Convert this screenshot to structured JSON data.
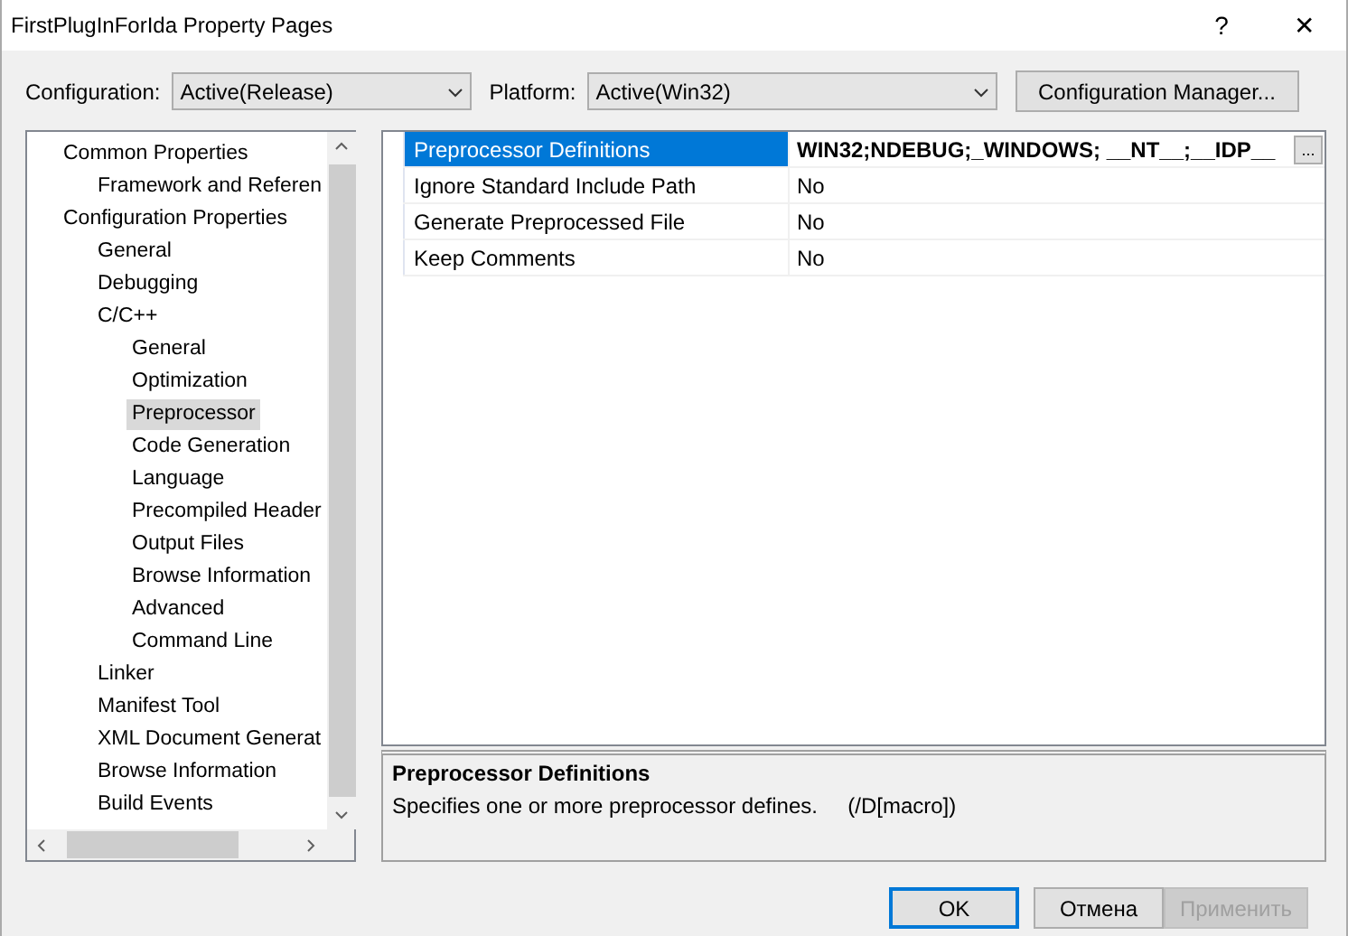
{
  "window": {
    "title": "FirstPlugInForIda Property Pages",
    "help": "?",
    "close": "✕"
  },
  "toolbar": {
    "configuration_label": "Configuration:",
    "configuration": "Active(Release)",
    "platform_label": "Platform:",
    "platform": "Active(Win32)",
    "manager_button": "Configuration Manager..."
  },
  "tree": [
    {
      "label": "Common Properties",
      "selected": false,
      "children": [
        {
          "label": "Framework and Referen",
          "selected": false
        }
      ]
    },
    {
      "label": "Configuration Properties",
      "selected": false,
      "children": [
        {
          "label": "General",
          "selected": false
        },
        {
          "label": "Debugging",
          "selected": false
        },
        {
          "label": "C/C++",
          "selected": false,
          "children": [
            {
              "label": "General",
              "selected": false
            },
            {
              "label": "Optimization",
              "selected": false
            },
            {
              "label": "Preprocessor",
              "selected": true
            },
            {
              "label": "Code Generation",
              "selected": false
            },
            {
              "label": "Language",
              "selected": false
            },
            {
              "label": "Precompiled Header",
              "selected": false
            },
            {
              "label": "Output Files",
              "selected": false
            },
            {
              "label": "Browse Information",
              "selected": false
            },
            {
              "label": "Advanced",
              "selected": false
            },
            {
              "label": "Command Line",
              "selected": false
            }
          ]
        },
        {
          "label": "Linker",
          "selected": false
        },
        {
          "label": "Manifest Tool",
          "selected": false
        },
        {
          "label": "XML Document Generat",
          "selected": false
        },
        {
          "label": "Browse Information",
          "selected": false
        },
        {
          "label": "Build Events",
          "selected": false
        }
      ]
    }
  ],
  "properties": [
    {
      "name": "Preprocessor Definitions",
      "value": "WIN32;NDEBUG;_WINDOWS; __NT__;__IDP__",
      "selected": true,
      "modified": true,
      "button": "..."
    },
    {
      "name": "Ignore Standard Include Path",
      "value": "No",
      "selected": false,
      "modified": false
    },
    {
      "name": "Generate Preprocessed File",
      "value": "No",
      "selected": false,
      "modified": false
    },
    {
      "name": "Keep Comments",
      "value": "No",
      "selected": false,
      "modified": false
    }
  ],
  "description": {
    "title": "Preprocessor Definitions",
    "text": "Specifies one or more preprocessor defines.",
    "switch": "(/D[macro])"
  },
  "buttons": [
    {
      "label": "OK",
      "kind": "default",
      "disabled": false
    },
    {
      "label": "Отмена",
      "kind": "normal",
      "disabled": false
    },
    {
      "label": "Применить",
      "kind": "normal",
      "disabled": true
    }
  ]
}
